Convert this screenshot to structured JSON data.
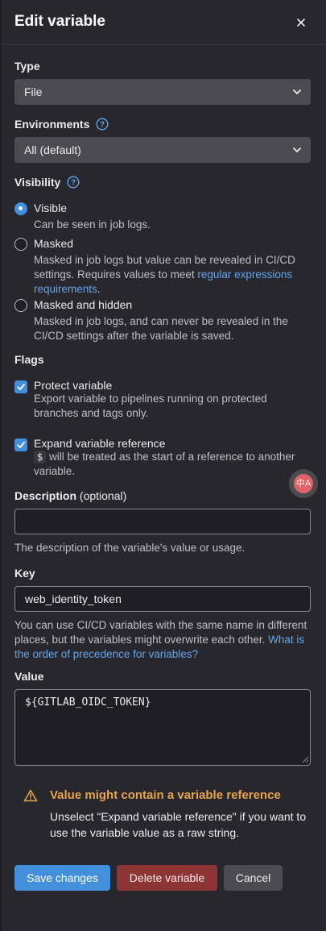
{
  "header": {
    "title": "Edit variable"
  },
  "type": {
    "label": "Type",
    "value": "File"
  },
  "environments": {
    "label": "Environments",
    "value": "All (default)"
  },
  "visibility": {
    "label": "Visibility",
    "options": [
      {
        "title": "Visible",
        "desc": "Can be seen in job logs.",
        "selected": true
      },
      {
        "title": "Masked",
        "desc_before": "Masked in job logs but value can be revealed in CI/CD settings. Requires values to meet ",
        "link": "regular expressions requirements",
        "desc_after": ".",
        "selected": false
      },
      {
        "title": "Masked and hidden",
        "desc": "Masked in job logs, and can never be revealed in the CI/CD settings after the variable is saved.",
        "selected": false
      }
    ]
  },
  "flags": {
    "label": "Flags",
    "protect": {
      "title": "Protect variable",
      "desc": "Export variable to pipelines running on protected branches and tags only.",
      "checked": true
    },
    "expand": {
      "title": "Expand variable reference",
      "chip": "$",
      "desc_after": " will be treated as the start of a reference to another variable.",
      "checked": true
    }
  },
  "description": {
    "label": "Description",
    "optional": "(optional)",
    "value": "",
    "help": "The description of the variable's value or usage."
  },
  "key": {
    "label": "Key",
    "value": "web_identity_token",
    "help_before": "You can use CI/CD variables with the same name in different places, but the variables might overwrite each other. ",
    "help_link": "What is the order of precedence for variables?"
  },
  "value": {
    "label": "Value",
    "value": "${GITLAB_OIDC_TOKEN}"
  },
  "alert": {
    "title": "Value might contain a variable reference",
    "body": "Unselect \"Expand variable reference\" if you want to use the variable value as a raw string."
  },
  "buttons": {
    "save": "Save changes",
    "delete": "Delete variable",
    "cancel": "Cancel"
  },
  "translate_glyph": "中A",
  "colors": {
    "accent": "#428fdc",
    "danger": "#8d3435",
    "warning": "#e9a449",
    "background": "#28272d"
  }
}
